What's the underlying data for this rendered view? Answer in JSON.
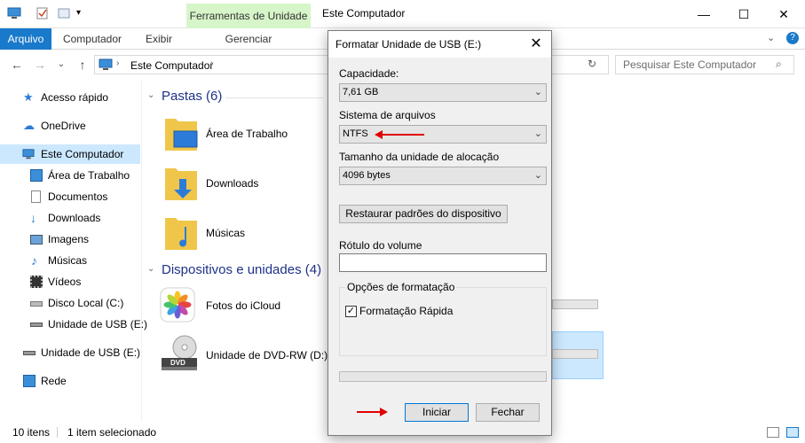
{
  "window": {
    "title": "Este Computador",
    "tools_tab": "Ferramentas de Unidade",
    "minimize": "—",
    "maximize": "☐",
    "close": "✕"
  },
  "ribbon": {
    "tabs": [
      "Arquivo",
      "Computador",
      "Exibir",
      "Gerenciar"
    ]
  },
  "address": {
    "path": "Este Computador",
    "search_placeholder": "Pesquisar Este Computador"
  },
  "nav": {
    "items": [
      {
        "label": "Acesso rápido",
        "icon": "star-icon"
      },
      {
        "label": "OneDrive",
        "icon": "cloud-icon"
      },
      {
        "label": "Este Computador",
        "icon": "computer-icon"
      },
      {
        "label": "Área de Trabalho",
        "icon": "desktop-icon"
      },
      {
        "label": "Documentos",
        "icon": "document-icon"
      },
      {
        "label": "Downloads",
        "icon": "download-icon"
      },
      {
        "label": "Imagens",
        "icon": "image-icon"
      },
      {
        "label": "Músicas",
        "icon": "music-icon"
      },
      {
        "label": "Vídeos",
        "icon": "video-icon"
      },
      {
        "label": "Disco Local (C:)",
        "icon": "drive-icon"
      },
      {
        "label": "Unidade de USB (E:)",
        "icon": "usb-icon"
      },
      {
        "label": "Unidade de USB (E:)",
        "icon": "usb-icon"
      },
      {
        "label": "Rede",
        "icon": "network-icon"
      }
    ]
  },
  "content": {
    "folders_header": "Pastas (6)",
    "folders": [
      "Área de Trabalho",
      "Downloads",
      "Músicas"
    ],
    "devices_header": "Dispositivos e unidades (4)",
    "devices": [
      "Fotos do iCloud",
      "Unidade de DVD-RW (D:)"
    ],
    "dvd_badge": "DVD"
  },
  "status": {
    "items": "10 itens",
    "selected": "1 item selecionado"
  },
  "dialog": {
    "title": "Formatar Unidade de USB (E:)",
    "capacity_label": "Capacidade:",
    "capacity_value": "7,61 GB",
    "fs_label": "Sistema de arquivos",
    "fs_value": "NTFS",
    "alloc_label": "Tamanho da unidade de alocação",
    "alloc_value": "4096 bytes",
    "restore_button": "Restaurar padrões do dispositivo",
    "volume_label": "Rótulo do volume",
    "volume_value": "",
    "options_label": "Opções de formatação",
    "quick_format": "Formatação Rápida",
    "quick_checked": "✓",
    "start_button": "Iniciar",
    "close_button": "Fechar",
    "close_icon": "✕"
  },
  "colors": {
    "accent": "#1979ca",
    "selected": "#cce8ff",
    "tools_tab": "#d6f5c8",
    "arrow": "#e00000",
    "group_header": "#1e3287"
  }
}
